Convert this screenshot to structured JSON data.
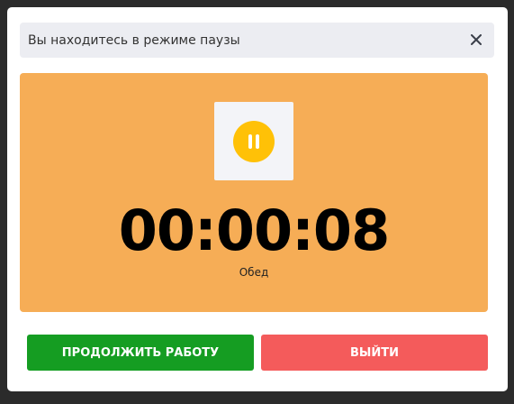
{
  "modal": {
    "title": "Вы находитесь в режиме паузы",
    "close_icon": "close-icon",
    "pause_icon": "pause-icon",
    "timer": "00:00:08",
    "reason": "Обед",
    "continue_label": "ПРОДОЛЖИТЬ РАБОТУ",
    "exit_label": "ВЫЙТИ"
  },
  "colors": {
    "panel": "#f6ad56",
    "pause_circle": "#ffc107",
    "continue_button": "#159d22",
    "exit_button": "#f45b5b",
    "header": "#ecedf2"
  }
}
